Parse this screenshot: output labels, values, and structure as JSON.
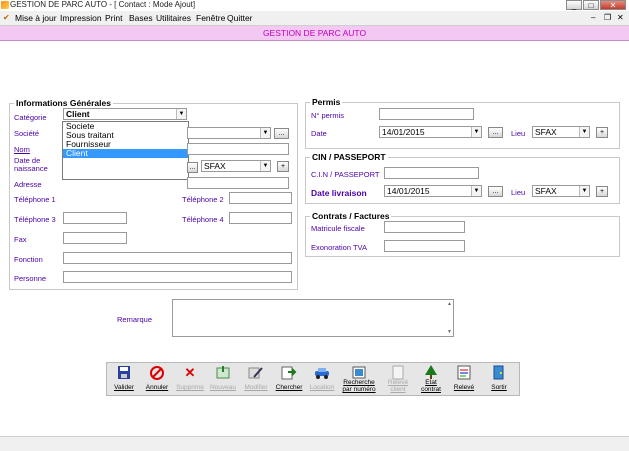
{
  "window": {
    "title": "GESTION DE PARC AUTO - [ Contact : Mode Ajout]"
  },
  "menu": [
    "Mise à jour",
    "Impression",
    "Print",
    "Bases",
    "Utilitaires",
    "Fenêtre",
    "Quitter"
  ],
  "header": {
    "title": "GESTION DE PARC AUTO"
  },
  "infos": {
    "legend": "Informations Générales",
    "categorie_label": "Catégorie",
    "categorie_value": "Client",
    "categorie_options": [
      "Societe",
      "Sous traitant",
      "Fournisseur",
      "Client"
    ],
    "societe_label": "Société",
    "nom_label": "Nom",
    "date_naissance_label": "Date de naissance",
    "lieu_value": "SFAX",
    "adresse_label": "Adresse",
    "tel1_label": "Téléphone 1",
    "tel2_label": "Téléphone 2",
    "tel3_label": "Téléphone 3",
    "tel4_label": "Téléphone 4",
    "fax_label": "Fax",
    "fonction_label": "Fonction",
    "personne_label": "Personne",
    "browse": "...",
    "plus": "+"
  },
  "permis": {
    "legend": "Permis",
    "numero_label": "N° permis",
    "date_label": "Date",
    "date_value": "14/01/2015",
    "lieu_label": "Lieu",
    "lieu_value": "SFAX"
  },
  "cin": {
    "legend": "CIN / PASSEPORT",
    "cin_label": "C.I.N / PASSEPORT",
    "date_label": "Date livraison",
    "date_value": "14/01/2015",
    "lieu_label": "Lieu",
    "lieu_value": "SFAX"
  },
  "contrats": {
    "legend": "Contrats / Factures",
    "matricule_label": "Matricule fiscale",
    "exoneration_label": "Exonoration TVA"
  },
  "remarque_label": "Remarque",
  "toolbar": {
    "valider": "Valider",
    "annuler": "Annuler",
    "supprimer": "Supprime",
    "nouveau": "Nouveau",
    "modifier": "Modifier",
    "chercher": "Chercher",
    "location": "Location",
    "recherche": "Recherche par numéro",
    "releve_client": "Relevé client",
    "etat_contrat": "Etat contrat",
    "releve": "Relevé",
    "sortir": "Sortir"
  },
  "colors": {
    "header_bg": "#f3c8f2",
    "header_text": "#c000c0",
    "label": "#4a00a8",
    "selection": "#3399ff"
  }
}
